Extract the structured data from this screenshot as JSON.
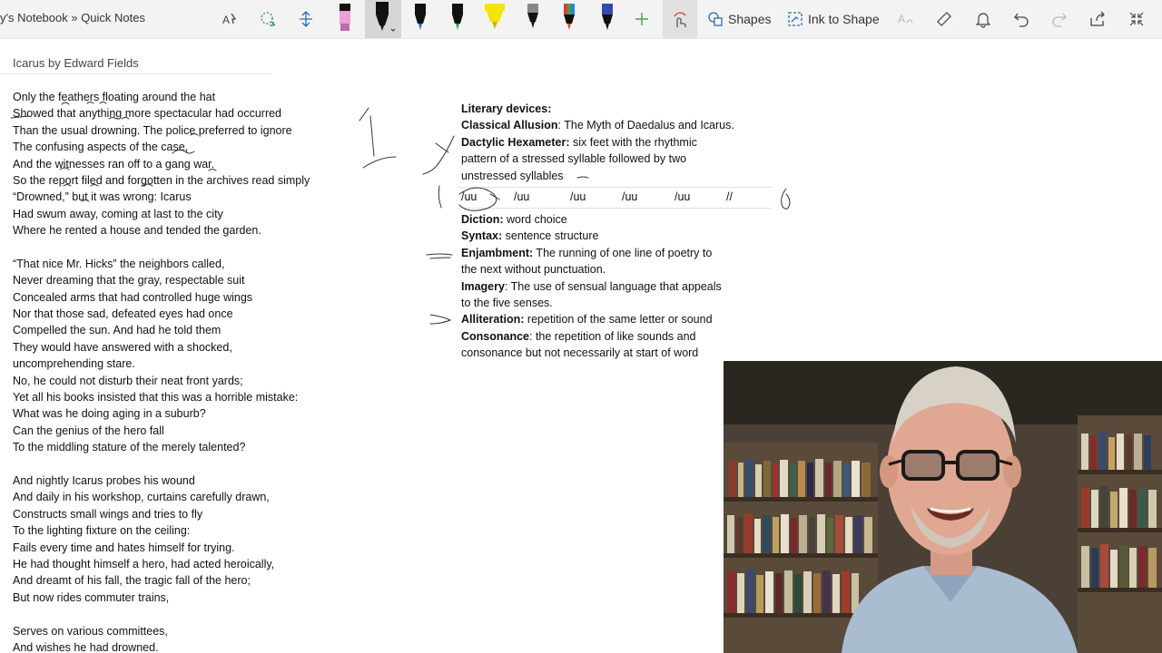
{
  "toolbar": {
    "breadcrumb": "y's Notebook » Quick Notes",
    "shapes_label": "Shapes",
    "ink_to_shape_label": "Ink to Shape"
  },
  "page": {
    "title": "Icarus by Edward Fields"
  },
  "poem": {
    "stanzas": [
      [
        "Only the feathers floating around the hat",
        "Showed that anything more spectacular had occurred",
        "Than the usual drowning. The police preferred to ignore",
        "The confusing aspects of the case,",
        "And the witnesses ran off to a gang war.",
        "So the report filed and forgotten in the archives read simply",
        "“Drowned,” but it was wrong: Icarus",
        "Had swum away, coming at last to the city",
        "Where he rented a house and tended the garden."
      ],
      [
        "“That nice Mr. Hicks” the neighbors called,",
        "Never dreaming that the gray, respectable suit",
        "Concealed arms that had controlled huge wings",
        "Nor that those sad, defeated eyes had once",
        "Compelled the sun. And had he told them",
        "They would have answered with a shocked,",
        "uncomprehending stare.",
        "No, he could not disturb their neat front yards;",
        "Yet all his books insisted that this was a horrible mistake:",
        "What was he doing aging in a suburb?",
        "Can the genius of the hero fall",
        "To the middling stature of the merely talented?"
      ],
      [
        "And nightly Icarus probes his wound",
        "And daily in his workshop, curtains carefully drawn,",
        "Constructs small wings and tries to fly",
        "To the lighting fixture on the ceiling:",
        "Fails every time and hates himself for trying.",
        "He had thought himself a hero, had acted heroically,",
        "And dreamt of his fall, the tragic fall of the hero;",
        "But now rides commuter trains,"
      ],
      [
        "Serves on various committees,",
        "And wishes he had drowned."
      ]
    ]
  },
  "notes": {
    "heading": "Literary devices:",
    "allusion_term": "Classical Allusion",
    "allusion_def": ": The Myth of Daedalus and Icarus.",
    "dactylic_term": "Dactylic Hexameter:",
    "dactylic_def_1": " six feet with the rhythmic",
    "dactylic_def_2": "pattern of a stressed syllable followed by two",
    "dactylic_def_3": "unstressed syllables",
    "meter_feet": [
      "/uu",
      "/uu",
      "/uu",
      "/uu",
      "/uu",
      "//"
    ],
    "diction_term": "Diction:",
    "diction_def": " word choice",
    "syntax_term": "Syntax:",
    "syntax_def": " sentence structure",
    "enjambment_term": "Enjambment:",
    "enjambment_def_1": " The running of one line of poetry to",
    "enjambment_def_2": "the next without punctuation.",
    "imagery_term": "Imagery",
    "imagery_def_1": ": The use of sensual language that appeals",
    "imagery_def_2": "to the five senses.",
    "alliteration_term": "Alliteration:",
    "alliteration_def": " repetition of the same letter or sound",
    "consonance_term": "Consonance",
    "consonance_def_1": ": the repetition of like sounds and",
    "consonance_def_2": "consonance but not necessarily at start of word"
  },
  "colors": {
    "toolbar_bg": "#f3f3f3",
    "accent_blue": "#2b6cb0",
    "ink": "#333333"
  }
}
